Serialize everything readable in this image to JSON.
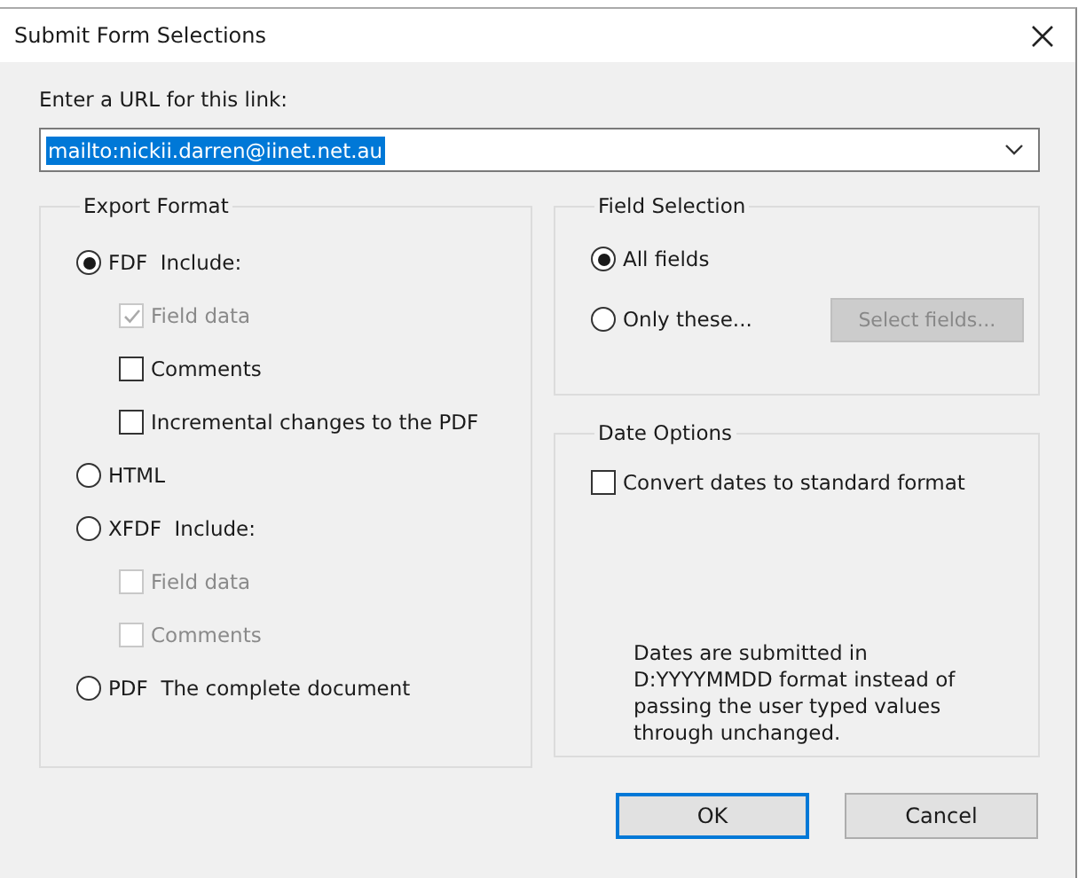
{
  "window": {
    "title": "Submit Form Selections"
  },
  "url": {
    "label": "Enter a URL for this link:",
    "value": "mailto:nickii.darren@iinet.net.au",
    "text_selected": true
  },
  "export_format": {
    "title": "Export Format",
    "options": [
      {
        "label": "FDF  Include:",
        "selected": true,
        "includes": [
          {
            "label": "Field data",
            "checked": true,
            "disabled": true
          },
          {
            "label": "Comments",
            "checked": false,
            "disabled": false
          },
          {
            "label": "Incremental changes to the PDF",
            "checked": false,
            "disabled": false
          }
        ]
      },
      {
        "label": "HTML",
        "selected": false
      },
      {
        "label": "XFDF  Include:",
        "selected": false,
        "includes": [
          {
            "label": "Field data",
            "checked": false,
            "disabled": true
          },
          {
            "label": "Comments",
            "checked": false,
            "disabled": true
          }
        ]
      },
      {
        "label": "PDF  The complete document",
        "selected": false
      }
    ]
  },
  "field_selection": {
    "title": "Field Selection",
    "options": [
      {
        "label": "All fields",
        "selected": true
      },
      {
        "label": "Only these...",
        "selected": false
      }
    ],
    "button": {
      "label": "Select fields...",
      "disabled": true
    }
  },
  "date_options": {
    "title": "Date Options",
    "checkbox": {
      "label": "Convert dates to standard format",
      "checked": false
    },
    "note": "Dates are submitted in D:YYYYMMDD format instead of passing the user typed values through unchanged."
  },
  "buttons": [
    {
      "label": "OK",
      "default": true
    },
    {
      "label": "Cancel",
      "default": false
    }
  ]
}
